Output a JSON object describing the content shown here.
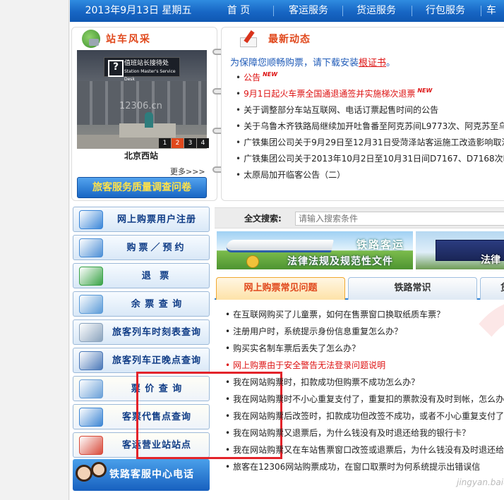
{
  "topnav": {
    "date": "2013年9月13日 星期五",
    "items": [
      "首 页",
      "客运服务",
      "货运服务",
      "行包服务",
      "车"
    ]
  },
  "photo_panel": {
    "title": "站车风采",
    "sign_line1": "值班站长接待处",
    "sign_line2": "Station Master's Service Desk",
    "watermark": "12306.cn",
    "slide_numbers": [
      "1",
      "2",
      "3",
      "4"
    ],
    "active_slide": "2",
    "caption": "北京西站",
    "more": "更多>>>",
    "survey_button": "旅客服务质量调查问卷"
  },
  "news_panel": {
    "title": "最新动态",
    "notice_prefix": "为保障您顺畅购票，请下载安装",
    "notice_link": "根证书",
    "notice_suffix": "。",
    "badge": "NEW",
    "items": [
      {
        "text": "公告",
        "red": true,
        "new": true
      },
      {
        "text": "9月1日起火车票全国通退通签并实施梯次退票",
        "red": true,
        "new": true
      },
      {
        "text": "关于调整部分车站互联网、电话订票起售时间的公告",
        "red": false,
        "new": false
      },
      {
        "text": "关于乌鲁木齐铁路局继续加开吐鲁番至阿克苏间L9773次、阿克苏至乌",
        "red": false,
        "new": false
      },
      {
        "text": "广铁集团公司关于9月29日至12月31日受菏泽站客运施工改造影响取消",
        "red": false,
        "new": false
      },
      {
        "text": "广铁集团公司关于2013年10月2日至10月31日间D7167、D7168次临",
        "red": false,
        "new": false
      },
      {
        "text": "太原局加开临客公告（二）",
        "red": false,
        "new": false
      }
    ]
  },
  "left_buttons": [
    {
      "label": "网上购票用户注册",
      "icon": "user-computer-icon",
      "color": "#3a86d8"
    },
    {
      "label": "购票／预约",
      "icon": "ticket-screen-icon",
      "color": "#4c8fd6"
    },
    {
      "label": "退 票",
      "icon": "return-arrow-icon",
      "color": "#3aa347"
    },
    {
      "label": "余 票 查 询",
      "icon": "ticket-list-icon",
      "color": "#5b9bd8"
    },
    {
      "label": "旅客列车时刻表查询",
      "icon": "bullet-train-icon",
      "color": "#8aa3bd"
    },
    {
      "label": "旅客列车正晚点查询",
      "icon": "clock-icon",
      "color": "#4a78b8"
    },
    {
      "label": "票 价 查 询",
      "icon": "price-ticket-icon",
      "color": "#6aa0d8"
    },
    {
      "label": "客票代售点查询",
      "icon": "shop-icon",
      "color": "#3d86d4"
    },
    {
      "label": "客运营业站站点",
      "icon": "station-house-icon",
      "color": "#d84a3a"
    }
  ],
  "hotline": "铁路客服中心电话",
  "search": {
    "label": "全文搜索:",
    "placeholder": "请输入搜索条件"
  },
  "banner": {
    "left_title": "铁路客运",
    "left_subtitle": "法律法规及规范性文件",
    "right_text": "法律"
  },
  "tabs": [
    "网上购票常见问题",
    "铁路常识",
    "货"
  ],
  "faq": [
    {
      "text": "在互联网购买了儿童票，如何在售票窗口换取纸质车票？",
      "red": false
    },
    {
      "text": "注册用户时，系统提示身份信息重复怎么办？",
      "red": false
    },
    {
      "text": "购买实名制车票后丢失了怎么办？",
      "red": false
    },
    {
      "text": "网上购票由于安全警告无法登录问题说明",
      "red": true
    },
    {
      "text": "我在网站购票时，扣款成功但购票不成功怎么办？",
      "red": false
    },
    {
      "text": "我在网站购票时不小心重复支付了，重复扣的票款没有及时到帐，怎么办",
      "red": false
    },
    {
      "text": "我在网站购票后改签时，扣款成功但改签不成功，或者不小心重复支付了",
      "red": false
    },
    {
      "text": "我在网站购票又退票后，为什么钱没有及时退还给我的银行卡？",
      "red": false
    },
    {
      "text": "我在网站购票又在车站售票窗口改签或退票后，为什么钱没有及时退还给",
      "red": false
    },
    {
      "text": "旅客在12306网站购票成功，在窗口取票时为何系统提示出错误信",
      "red": false
    }
  ],
  "footer_watermark": "jingyan.baidu.com",
  "highlight_color": "#e3232a"
}
